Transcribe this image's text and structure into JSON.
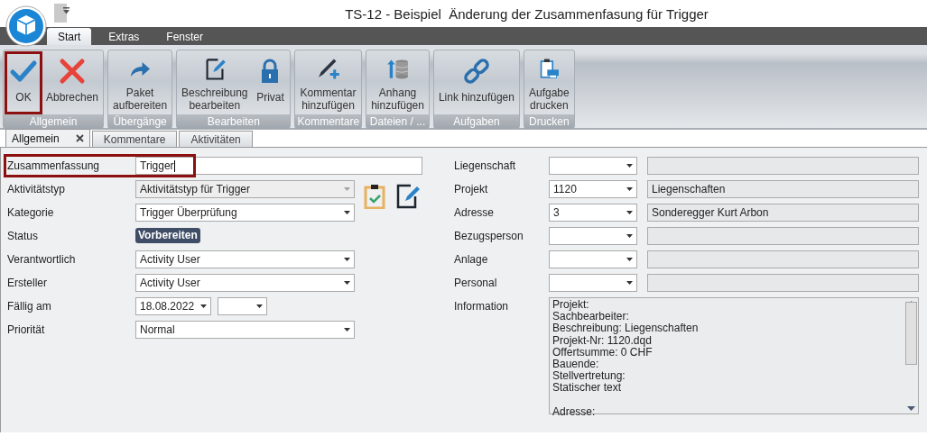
{
  "window": {
    "title": "TS-12 - Beispiel  Änderung der Zusammenfasung für Trigger"
  },
  "ribbon": {
    "tabs": [
      {
        "label": "Start",
        "selected": true
      },
      {
        "label": "Extras",
        "selected": false
      },
      {
        "label": "Fenster",
        "selected": false
      }
    ],
    "groups": [
      {
        "label": "Allgemein",
        "buttons": [
          {
            "label": "OK",
            "highlighted": true
          },
          {
            "label": "Abbrechen",
            "highlighted": false
          }
        ]
      },
      {
        "label": "Übergänge",
        "buttons": [
          {
            "label": "Paket\naufbereiten",
            "highlighted": false
          }
        ]
      },
      {
        "label": "Bearbeiten",
        "buttons": [
          {
            "label": "Beschreibung\nbearbeiten",
            "highlighted": false
          },
          {
            "label": "Privat",
            "highlighted": false
          }
        ]
      },
      {
        "label": "Kommentare",
        "buttons": [
          {
            "label": "Kommentar\nhinzufügen",
            "highlighted": false
          }
        ]
      },
      {
        "label": "Dateien / ...",
        "buttons": [
          {
            "label": "Anhang\nhinzufügen",
            "highlighted": false
          }
        ]
      },
      {
        "label": "Aufgaben",
        "buttons": [
          {
            "label": "Link hinzufügen",
            "highlighted": false
          }
        ]
      },
      {
        "label": "Drucken",
        "buttons": [
          {
            "label": "Aufgabe\ndrucken",
            "highlighted": false
          }
        ]
      }
    ]
  },
  "document_tabs": [
    {
      "label": "Allgemein",
      "selected": true
    },
    {
      "label": "Kommentare",
      "selected": false
    },
    {
      "label": "Aktivitäten",
      "selected": false
    }
  ],
  "form_left": [
    {
      "kind": "text",
      "label": "Zusammenfassung",
      "value": "Trigger",
      "focused": true,
      "highlighted": true
    },
    {
      "kind": "combo",
      "label": "Aktivitätstyp",
      "value": "Aktivitätstyp für Trigger",
      "disabled": true
    },
    {
      "kind": "combo",
      "label": "Kategorie",
      "value": "Trigger Überprüfung",
      "disabled": false
    },
    {
      "kind": "badge",
      "label": "Status",
      "value": "Vorbereiten"
    },
    {
      "kind": "combo",
      "label": "Verantwortlich",
      "value": "Activity User",
      "disabled": false
    },
    {
      "kind": "combo",
      "label": "Ersteller",
      "value": "Activity User",
      "disabled": false
    },
    {
      "kind": "date",
      "label": "Fällig am",
      "value": "18.08.2022"
    },
    {
      "kind": "combo",
      "label": "Priorität",
      "value": "Normal",
      "disabled": false
    }
  ],
  "form_right": [
    {
      "kind": "lookup",
      "label": "Liegenschaft"
    },
    {
      "kind": "lookup",
      "label": "Projekt",
      "code": "1120",
      "description": "Liegenschaften"
    },
    {
      "kind": "lookup",
      "label": "Adresse",
      "code": "3",
      "description": "Sonderegger Kurt Arbon"
    },
    {
      "kind": "lookup",
      "label": "Bezugsperson"
    },
    {
      "kind": "lookup",
      "label": "Anlage"
    },
    {
      "kind": "lookup",
      "label": "Personal"
    },
    {
      "kind": "memo",
      "label": "Information",
      "value": "Projekt:\nSachbearbeiter:\nBeschreibung: Liegenschaften\nProjekt-Nr: 1120.dqd\nOffertsumme: 0 CHF\nBauende:\nStellvertretung:\nStatischer text\n\nAdresse:"
    }
  ]
}
